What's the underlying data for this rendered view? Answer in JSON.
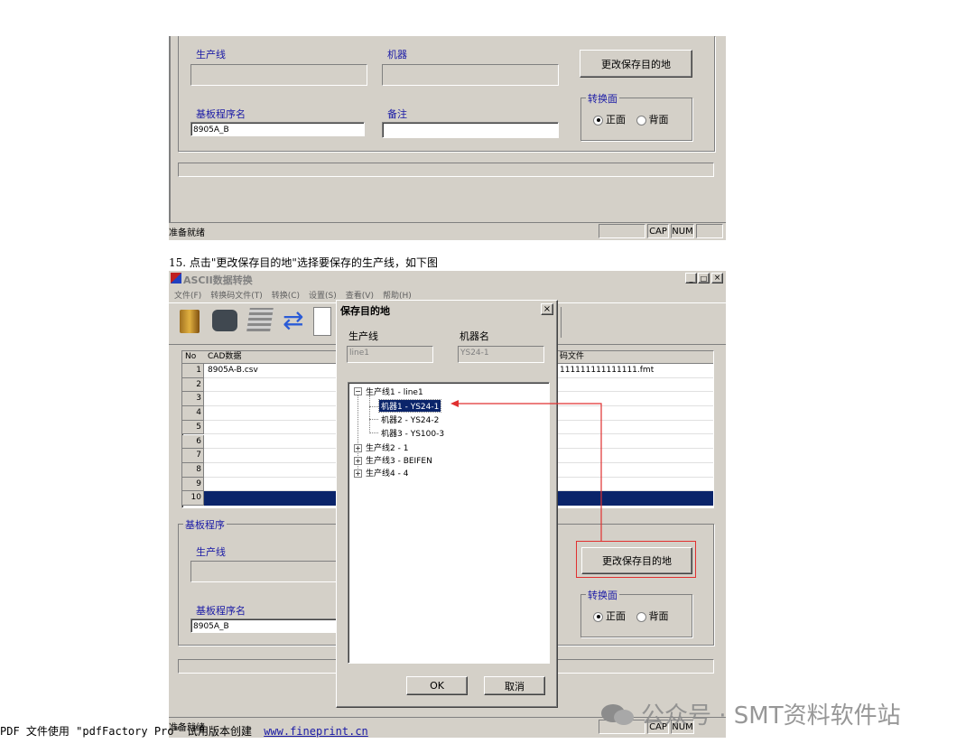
{
  "top_shot": {
    "production_line_label": "生产线",
    "machine_label": "机器",
    "change_dest_button": "更改保存目的地",
    "board_program_label": "基板程序名",
    "board_program_value": "8905A_B",
    "note_label": "备注",
    "convert_side_title": "转换面",
    "side_front": "正面",
    "side_back": "背面",
    "status_text": "准备就绪",
    "status_cap": "CAP",
    "status_num": "NUM"
  },
  "step_caption": "15. 点击\"更改保存目的地\"选择要保存的生产线，如下图",
  "main_window": {
    "title": "ASCII数据转换",
    "menu": [
      "文件(F)",
      "转换码文件(T)",
      "转换(C)",
      "设置(S)",
      "查看(V)",
      "帮助(H)"
    ],
    "toolbar_icons": [
      "open-folder-icon",
      "comment-icon",
      "notebook-icon",
      "refresh-icon",
      "new-icon"
    ],
    "grid_headers": {
      "no": "No",
      "cad": "CAD数据",
      "code": "码文件"
    },
    "grid_rows": [
      {
        "no": "1",
        "cad": "8905A-B.csv",
        "code": "111111111111111.fmt"
      },
      {
        "no": "2",
        "cad": "",
        "code": ""
      },
      {
        "no": "3",
        "cad": "",
        "code": ""
      },
      {
        "no": "4",
        "cad": "",
        "code": ""
      },
      {
        "no": "5",
        "cad": "",
        "code": ""
      },
      {
        "no": "6",
        "cad": "",
        "code": ""
      },
      {
        "no": "7",
        "cad": "",
        "code": ""
      },
      {
        "no": "8",
        "cad": "",
        "code": ""
      },
      {
        "no": "9",
        "cad": "",
        "code": ""
      },
      {
        "no": "10",
        "cad": "",
        "code": ""
      }
    ],
    "board_group_title": "基板程序",
    "production_line_label": "生产线",
    "board_program_label": "基板程序名",
    "board_program_value": "8905A_B",
    "change_dest_button": "更改保存目的地",
    "convert_side_title": "转换面",
    "side_front": "正面",
    "side_back": "背面",
    "status_text": "准备就绪",
    "status_cap": "CAP",
    "status_num": "NUM"
  },
  "dialog": {
    "title": "保存目的地",
    "line_label": "生产线",
    "machine_name_label": "机器名",
    "line_value": "line1",
    "machine_value": "YS24-1",
    "tree": [
      {
        "label": "生产线1 - line1",
        "expanded": true,
        "children": [
          {
            "label": "机器1 - YS24-1",
            "selected": true
          },
          {
            "label": "机器2 - YS24-2"
          },
          {
            "label": "机器3 - YS100-3"
          }
        ]
      },
      {
        "label": "生产线2 - 1",
        "expanded": false
      },
      {
        "label": "生产线3 - BEIFEN",
        "expanded": false
      },
      {
        "label": "生产线4 - 4",
        "expanded": false
      }
    ],
    "ok_button": "OK",
    "cancel_button": "取消"
  },
  "highlight_color": "#e03030",
  "selection_color": "#0a246a",
  "watermark": "公众号 · SMT资料软件站",
  "footer": {
    "text": "PDF 文件使用 \"pdfFactory Pro\" 试用版本创建",
    "link": "www.fineprint.cn"
  }
}
